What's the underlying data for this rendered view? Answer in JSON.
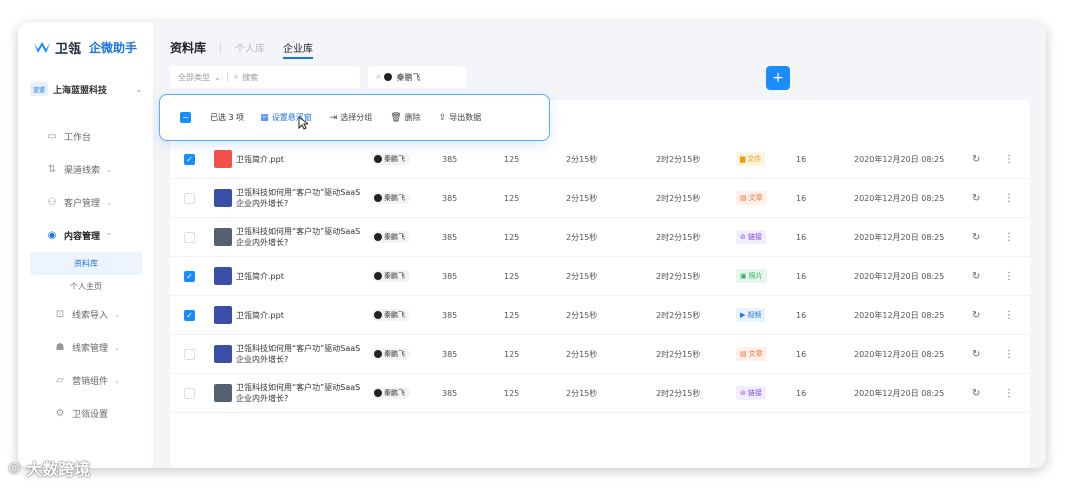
{
  "app": {
    "brand": "卫瓴",
    "subtitle": "企微助手",
    "company": "上海蓝盟科技",
    "company_badge": "蓝盟"
  },
  "sidebar": {
    "items": [
      {
        "label": "工作台",
        "icon": "monitor-icon"
      },
      {
        "label": "渠道线索",
        "icon": "channel-icon",
        "caret": "⌄"
      },
      {
        "label": "客户管理",
        "icon": "users-icon",
        "caret": "⌄"
      },
      {
        "label": "内容管理",
        "icon": "content-icon",
        "caret": "⌃",
        "active": true
      }
    ],
    "sub_items": [
      {
        "label": "资料库",
        "active": true
      },
      {
        "label": "个人主页"
      }
    ],
    "items2": [
      {
        "label": "线索导入",
        "icon": "import-icon",
        "caret": "⌄"
      },
      {
        "label": "线索管理",
        "icon": "lead-icon",
        "caret": "⌄"
      },
      {
        "label": "营销组件",
        "icon": "component-icon",
        "caret": "⌄"
      },
      {
        "label": "卫瓴设置",
        "icon": "settings-icon"
      }
    ]
  },
  "header": {
    "title": "资料库",
    "tabs": [
      {
        "label": "个人库"
      },
      {
        "label": "企业库",
        "active": true
      }
    ]
  },
  "filters": {
    "type": "全部类型",
    "search_placeholder": "搜索",
    "owner": "秦鹏飞"
  },
  "toolbar": {
    "selected": "已选 3 项",
    "set_float": "设置悬浮窗",
    "choose_group": "选择分组",
    "delete": "删除",
    "export": "导出数据"
  },
  "table": {
    "rows": [
      {
        "checked": true,
        "thumb": "ppt",
        "title": "卫瓴简介.ppt",
        "owner": "秦鹏飞",
        "n1": "385",
        "n2": "125",
        "d1": "2分15秒",
        "d2": "2时2分15秒",
        "type": "文件",
        "type_class": "file",
        "type_icon": "file-icon",
        "count": "16",
        "date": "2020年12月20日 08:25"
      },
      {
        "checked": false,
        "thumb": "blue",
        "title": "卫瓴科技如何用“客户功”驱动SaaS企业内外增长?",
        "owner": "秦鹏飞",
        "n1": "385",
        "n2": "125",
        "d1": "2分15秒",
        "d2": "2时2分15秒",
        "type": "文章",
        "type_class": "article",
        "type_icon": "article-icon",
        "count": "16",
        "date": "2020年12月20日 08:25"
      },
      {
        "checked": false,
        "thumb": "photo",
        "title": "卫瓴科技如何用“客户功”驱动SaaS企业内外增长?",
        "owner": "秦鹏飞",
        "n1": "385",
        "n2": "125",
        "d1": "2分15秒",
        "d2": "2时2分15秒",
        "type": "链接",
        "type_class": "link",
        "type_icon": "link-icon",
        "count": "16",
        "date": "2020年12月20日 08:25"
      },
      {
        "checked": true,
        "thumb": "blue",
        "title": "卫瓴简介.ppt",
        "owner": "秦鹏飞",
        "n1": "385",
        "n2": "125",
        "d1": "2分15秒",
        "d2": "2时2分15秒",
        "type": "照片",
        "type_class": "photo",
        "type_icon": "photo-icon",
        "count": "16",
        "date": "2020年12月20日 08:25"
      },
      {
        "checked": true,
        "thumb": "blue",
        "title": "卫瓴简介.ppt",
        "owner": "秦鹏飞",
        "n1": "385",
        "n2": "125",
        "d1": "2分15秒",
        "d2": "2时2分15秒",
        "type": "视频",
        "type_class": "video",
        "type_icon": "video-icon",
        "count": "16",
        "date": "2020年12月20日 08:25"
      },
      {
        "checked": false,
        "thumb": "blue",
        "title": "卫瓴科技如何用“客户功”驱动SaaS企业内外增长?",
        "owner": "秦鹏飞",
        "n1": "385",
        "n2": "125",
        "d1": "2分15秒",
        "d2": "2时2分15秒",
        "type": "文章",
        "type_class": "article",
        "type_icon": "article-icon",
        "count": "16",
        "date": "2020年12月20日 08:25"
      },
      {
        "checked": false,
        "thumb": "photo",
        "title": "卫瓴科技如何用“客户功”驱动SaaS企业内外增长?",
        "owner": "秦鹏飞",
        "n1": "385",
        "n2": "125",
        "d1": "2分15秒",
        "d2": "2时2分15秒",
        "type": "链接",
        "type_class": "link",
        "type_icon": "link-icon",
        "count": "16",
        "date": "2020年12月20日 08:25"
      }
    ]
  },
  "watermark": "大数跨境",
  "colors": {
    "accent": "#1a73e8",
    "add_button": "#1a8cff"
  }
}
